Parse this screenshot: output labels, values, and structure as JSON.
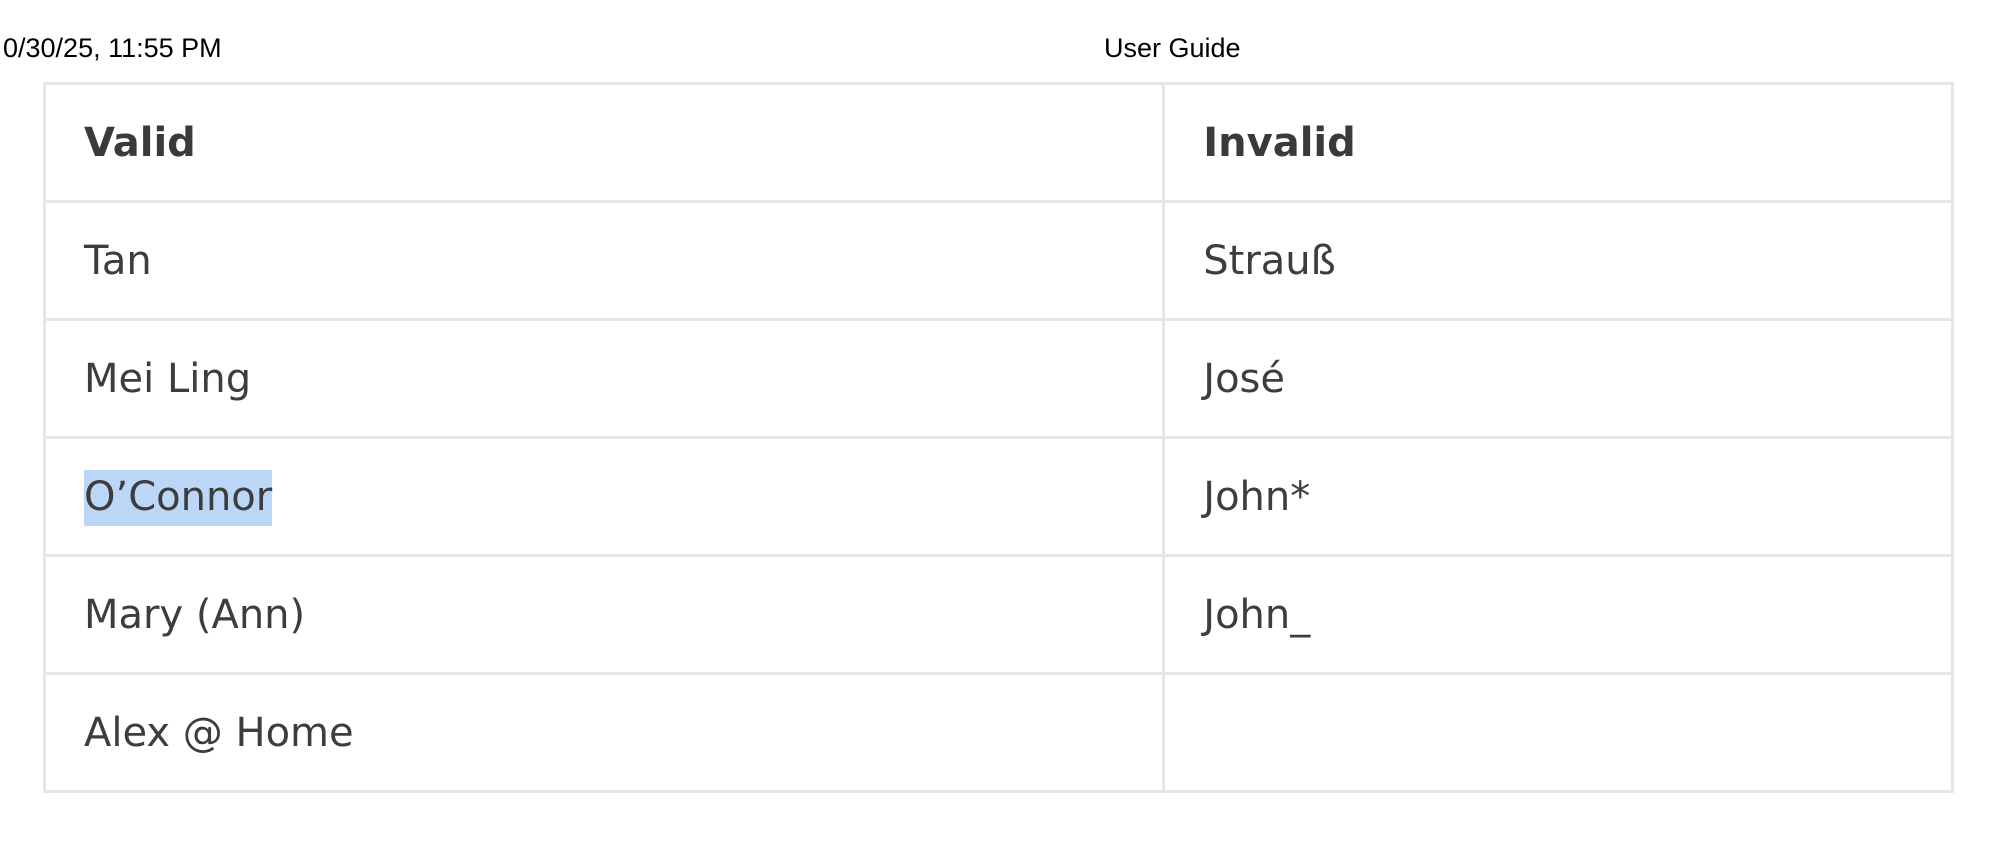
{
  "print_header": {
    "datetime": "0/30/25, 11:55 PM",
    "title": "User Guide"
  },
  "table": {
    "headers": {
      "valid": "Valid",
      "invalid": "Invalid"
    },
    "rows": [
      {
        "valid": "Tan",
        "invalid": "Strauß"
      },
      {
        "valid": "Mei Ling",
        "invalid": "José"
      },
      {
        "valid": "O’Connor",
        "invalid": "John*"
      },
      {
        "valid": "Mary (Ann)",
        "invalid": "John_"
      },
      {
        "valid": "Alex @ Home",
        "invalid": ""
      }
    ]
  },
  "colors": {
    "text": "#3d3d3d",
    "border": "#e6e6e6",
    "selection_highlight": "#bcd6f7"
  }
}
